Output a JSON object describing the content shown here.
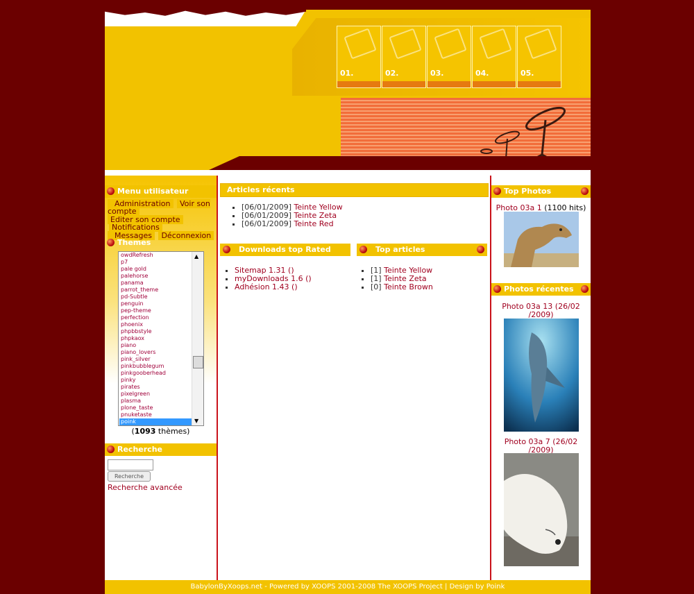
{
  "header": {
    "tabs": [
      {
        "num": "01.",
        "icon": "briefcase-icon"
      },
      {
        "num": "02.",
        "icon": "clipboard-icon"
      },
      {
        "num": "03.",
        "icon": "book-icon"
      },
      {
        "num": "04.",
        "icon": "tools-icon"
      },
      {
        "num": "05.",
        "icon": "envelope-icon"
      }
    ]
  },
  "user_menu": {
    "title": "Menu utilisateur",
    "items": [
      "Administration",
      "Voir son compte",
      "Editer son compte",
      "Notifications",
      "Messages",
      "Déconnexion"
    ]
  },
  "themes": {
    "title": "Themes",
    "options": [
      "owdRefresh",
      "p7",
      "pale gold",
      "palehorse",
      "panama",
      "parrot_theme",
      "pd-Subtle",
      "penguin",
      "pep-theme",
      "perfection",
      "phoenix",
      "phpbbstyle",
      "phpkaox",
      "piano",
      "piano_lovers",
      "pink_silver",
      "pinkbubblegum",
      "pinkgooberhead",
      "pinky",
      "pirates",
      "pixelgreen",
      "plasma",
      "plone_taste",
      "pnuketaste",
      "poink"
    ],
    "selected": "poink",
    "count_open": "(",
    "count": "1093",
    "count_suffix": " thèmes)"
  },
  "search": {
    "title": "Recherche",
    "input_value": "",
    "button": "Recherche",
    "advanced": "Recherche avancée"
  },
  "recent_articles": {
    "title": "Articles récents",
    "items": [
      {
        "date": "[06/01/2009]",
        "title": "Teinte Yellow"
      },
      {
        "date": "[06/01/2009]",
        "title": "Teinte Zeta"
      },
      {
        "date": "[06/01/2009]",
        "title": "Teinte Red"
      }
    ]
  },
  "downloads": {
    "title": "Downloads top Rated",
    "items": [
      "Sitemap 1.31 ()",
      "myDownloads 1.6 ()",
      "Adhésion 1.43 ()"
    ]
  },
  "top_articles": {
    "title": "Top articles",
    "items": [
      {
        "count": "[1]",
        "title": "Teinte Yellow"
      },
      {
        "count": "[1]",
        "title": "Teinte Zeta"
      },
      {
        "count": "[0]",
        "title": "Teinte Brown"
      }
    ]
  },
  "top_photos": {
    "title": "Top Photos",
    "caption_link": "Photo 03a 1",
    "caption_hits": " (1100 hits)"
  },
  "recent_photos": {
    "title": "Photos récentes",
    "items": [
      {
        "line1": "Photo 03a 13 (26/02",
        "line2": "/2009)"
      },
      {
        "line1": "Photo 03a 7 (26/02",
        "line2": "/2009)"
      }
    ]
  },
  "footer": {
    "text": "BabylonByXoops.net - Powered by XOOPS 2001-2008 The XOOPS Project  |  Design by Poink"
  },
  "colors": {
    "background": "#6b0000",
    "accent": "#f2c200",
    "link": "#a0001f"
  }
}
